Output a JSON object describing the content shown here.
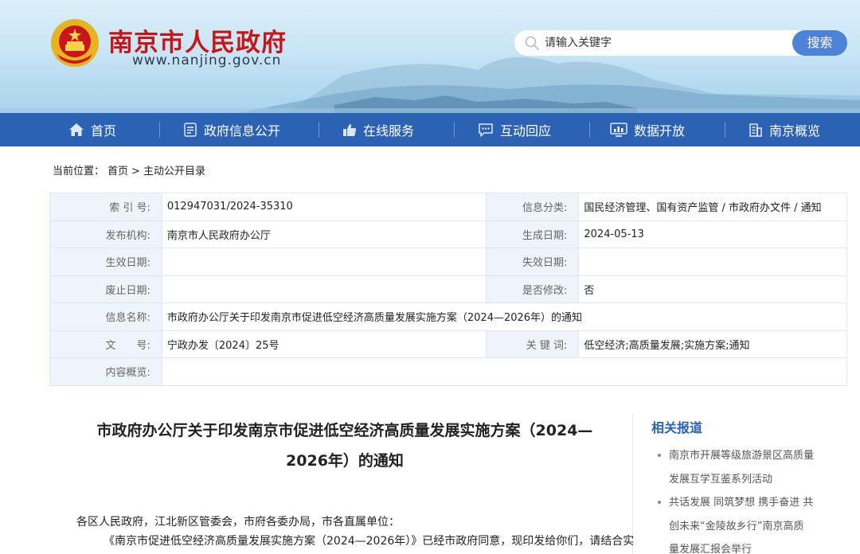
{
  "header": {
    "site_title": "南京市人民政府",
    "site_url": "www.nanjing.gov.cn",
    "search_placeholder": "请输入关键字",
    "search_button": "搜索"
  },
  "nav": [
    {
      "label": "首页",
      "icon": "home-icon"
    },
    {
      "label": "政府信息公开",
      "icon": "document-icon"
    },
    {
      "label": "在线服务",
      "icon": "thumbs-up-icon"
    },
    {
      "label": "互动回应",
      "icon": "chat-icon"
    },
    {
      "label": "数据开放",
      "icon": "monitor-chart-icon"
    },
    {
      "label": "南京概览",
      "icon": "building-icon"
    }
  ],
  "breadcrumb": {
    "prefix": "当前位置：",
    "home": "首页",
    "sep": ">",
    "current": "主动公开目录"
  },
  "meta": {
    "index_no_label": "索 引 号:",
    "index_no": "012947031/2024-35310",
    "category_label": "信息分类:",
    "category": "国民经济管理、国有资产监管 / 市政府办文件 / 通知",
    "publisher_label": "发布机构:",
    "publisher": "南京市人民政府办公厅",
    "created_label": "生成日期:",
    "created": "2024-05-13",
    "effective_label": "生效日期:",
    "effective": "",
    "expire_label": "失效日期:",
    "expire": "",
    "abolish_label": "废止日期:",
    "abolish": "",
    "modified_label": "是否修改:",
    "modified": "否",
    "name_label": "信息名称:",
    "name": "市政府办公厅关于印发南京市促进低空经济高质量发展实施方案（2024—2026年）的通知",
    "doc_no_label": "文　　号:",
    "doc_no": "宁政办发〔2024〕25号",
    "keywords_label": "关 键 词:",
    "keywords": "低空经济;高质量发展;实施方案;通知",
    "summary_label": "内容概览:",
    "summary": ""
  },
  "article": {
    "title_line1": "市政府办公厅关于印发南京市促进低空经济高质量发展实施方案（2024—",
    "title_line2": "2026年）的通知",
    "para1": "各区人民政府，江北新区管委会，市府各委办局，市各直属单位：",
    "para2": "《南京市促进低空经济高质量发展实施方案（2024—2026年）》已经市政府同意，现印发给你们，请结合实"
  },
  "related": {
    "title": "相关报道",
    "items": [
      {
        "line1": "南京市开展等级旅游景区高质量",
        "line2": "发展互学互鉴系列活动"
      },
      {
        "line1": "共话发展 同筑梦想 携手奋进 共",
        "line2": "创未来“金陵故乡行”南京高质",
        "line3": "量发展汇报会举行"
      }
    ]
  }
}
